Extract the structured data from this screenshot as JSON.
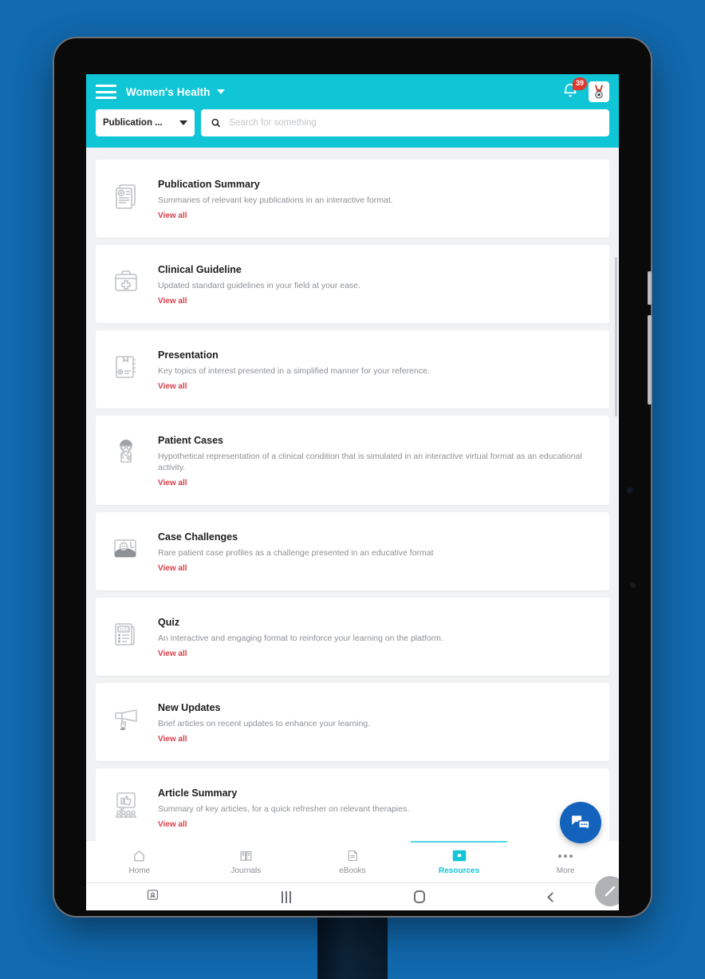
{
  "header": {
    "menu_icon": "hamburger-menu-icon",
    "brand": "Women's Health",
    "brand_chevron_icon": "chevron-down-icon",
    "notification_icon": "bell-icon",
    "notification_count": "39",
    "avatar_icon": "medal-award-icon"
  },
  "search": {
    "category_label": "Publication ...",
    "category_chevron_icon": "chevron-down-icon",
    "search_icon": "search-icon",
    "placeholder": "Search for something",
    "value": ""
  },
  "colors": {
    "header_teal": "#0FC5D6",
    "page_blue": "#1169AE",
    "link_red": "#D8404A",
    "badge_red": "#E0382F",
    "fab_blue": "#1363BC",
    "active_tab": "#0FC5D6"
  },
  "cards": [
    {
      "icon": "publication-document-icon",
      "title": "Publication Summary",
      "description": "Summaries of relevant key publications in an interactive format.",
      "link": "View all"
    },
    {
      "icon": "medical-bag-icon",
      "title": "Clinical Guideline",
      "description": "Updated standard guidelines in your field at your ease.",
      "link": "View all"
    },
    {
      "icon": "presentation-board-icon",
      "title": "Presentation",
      "description": "Key topics of interest presented in a simplified manner for your reference.",
      "link": "View all"
    },
    {
      "icon": "doctor-icon",
      "title": "Patient Cases",
      "description": "Hypothetical representation of a clinical condition that is simulated in an interactive virtual format as an educational activity.",
      "link": "View all"
    },
    {
      "icon": "patient-bed-photo-icon",
      "title": "Case Challenges",
      "description": "Rare patient case profiles as a challenge presented in an educative format",
      "link": "View all"
    },
    {
      "icon": "quiz-paper-icon",
      "title": "Quiz",
      "description": "An interactive and engaging format to reinforce your learning on the platform.",
      "link": "View all"
    },
    {
      "icon": "megaphone-icon",
      "title": "New Updates",
      "description": "Brief articles on recent updates to enhance your learning.",
      "link": "View all"
    },
    {
      "icon": "thumbs-up-audience-icon",
      "title": "Article Summary",
      "description": "Summary of key articles, for a quick refresher on relevant therapies.",
      "link": "View all"
    }
  ],
  "fab": {
    "chat_icon": "chat-bubbles-icon",
    "edit_icon": "pencil-edit-icon"
  },
  "tabbar": [
    {
      "icon": "home-icon",
      "label": "Home",
      "active": false
    },
    {
      "icon": "journals-icon",
      "label": "Journals",
      "active": false
    },
    {
      "icon": "ebooks-icon",
      "label": "eBooks",
      "active": false
    },
    {
      "icon": "resources-icon",
      "label": "Resources",
      "active": true
    },
    {
      "icon": "more-dots-icon",
      "label": "More",
      "active": false
    }
  ],
  "navbar": [
    {
      "icon": "recent-apps-icon"
    },
    {
      "icon": "menu-lines-icon"
    },
    {
      "icon": "home-square-icon"
    },
    {
      "icon": "back-chevron-icon"
    }
  ]
}
